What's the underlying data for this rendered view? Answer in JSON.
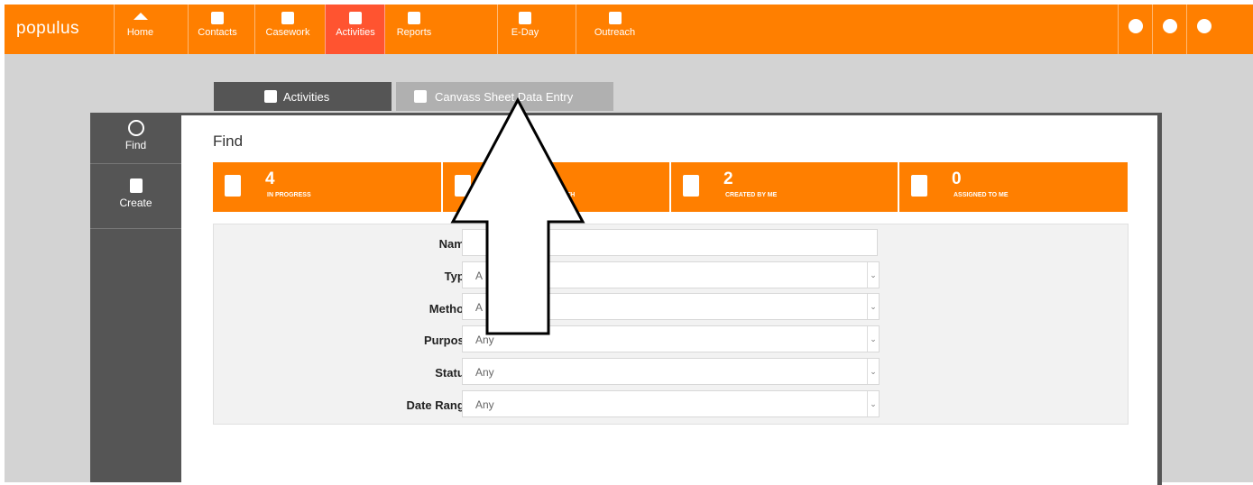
{
  "app": {
    "logo": "populus"
  },
  "colors": {
    "brand": "#ff7f00",
    "active_nav": "#ff5430",
    "sidebar": "#555555",
    "tab_inactive": "#b0b0b0"
  },
  "nav": {
    "items": [
      {
        "label": "Home",
        "icon": "home-icon"
      },
      {
        "label": "Contacts",
        "icon": "contacts-icon"
      },
      {
        "label": "Casework",
        "icon": "casework-icon"
      },
      {
        "label": "Activities",
        "icon": "activities-icon",
        "active": true
      },
      {
        "label": "Reports",
        "icon": "reports-icon"
      },
      {
        "label": "E-Day",
        "icon": "eday-icon"
      },
      {
        "label": "Outreach",
        "icon": "outreach-icon"
      }
    ],
    "right_icons": [
      "settings-icon",
      "info-icon",
      "user-icon"
    ]
  },
  "tabs": [
    {
      "label": "Activities",
      "icon": "activities-icon",
      "active": true
    },
    {
      "label": "Canvass Sheet Data Entry",
      "icon": "canvass-icon",
      "active": false
    }
  ],
  "sidebar": {
    "items": [
      {
        "label": "Find",
        "icon": "search-icon",
        "active": true
      },
      {
        "label": "Create",
        "icon": "create-activity-icon",
        "active": false
      }
    ]
  },
  "main": {
    "title": "Find",
    "stats": [
      {
        "number": "4",
        "label": "IN PROGRESS",
        "icon": "clipboard-clock-icon"
      },
      {
        "number": "",
        "label": "TH",
        "icon": "clipboard-icon"
      },
      {
        "number": "2",
        "label": "CREATED BY ME",
        "icon": "clipboard-icon"
      },
      {
        "number": "0",
        "label": "ASSIGNED TO ME",
        "icon": "clipboard-user-icon"
      }
    ],
    "form": {
      "name_label": "Name",
      "name_value": "",
      "fields": [
        {
          "label": "Type",
          "value": "A"
        },
        {
          "label": "Method",
          "value": "A"
        },
        {
          "label": "Purpose",
          "value": "Any"
        },
        {
          "label": "Status",
          "value": "Any"
        },
        {
          "label": "Date Range",
          "value": "Any"
        }
      ]
    }
  }
}
